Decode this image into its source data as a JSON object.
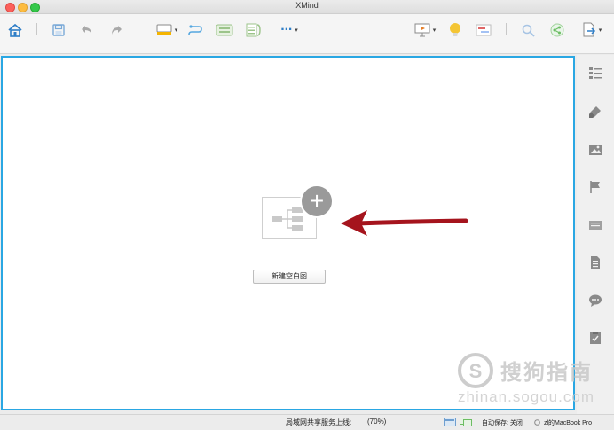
{
  "window": {
    "title": "XMind"
  },
  "toolbar": {
    "icons": [
      "home-icon",
      "save-icon",
      "undo-icon",
      "redo-icon",
      "topic-style-icon",
      "relationship-icon",
      "boundary-icon",
      "summary-icon",
      "more-icon",
      "presentation-icon",
      "idea-icon",
      "gantt-icon",
      "search-icon",
      "share-icon",
      "export-icon"
    ],
    "more_label": "···"
  },
  "main": {
    "new_blank_label": "新建空白图",
    "plus_glyph": "+"
  },
  "sidebar": {
    "icons": [
      "outline-icon",
      "format-brush-icon",
      "image-icon",
      "marker-flag-icon",
      "note-icon",
      "document-icon",
      "comment-icon",
      "task-clipboard-icon"
    ]
  },
  "status": {
    "lan_share": "局域网共享服务上线:",
    "zoom": "(70%)",
    "autosave": "自动保存: 关闭",
    "device": "zl的MacBook Pro"
  },
  "watermark": {
    "text": "搜狗指南",
    "url": "zhinan.sogou.com"
  },
  "colors": {
    "accent": "#2aa7e3",
    "arrow": "#a5141d",
    "bulb": "#f4c534"
  }
}
